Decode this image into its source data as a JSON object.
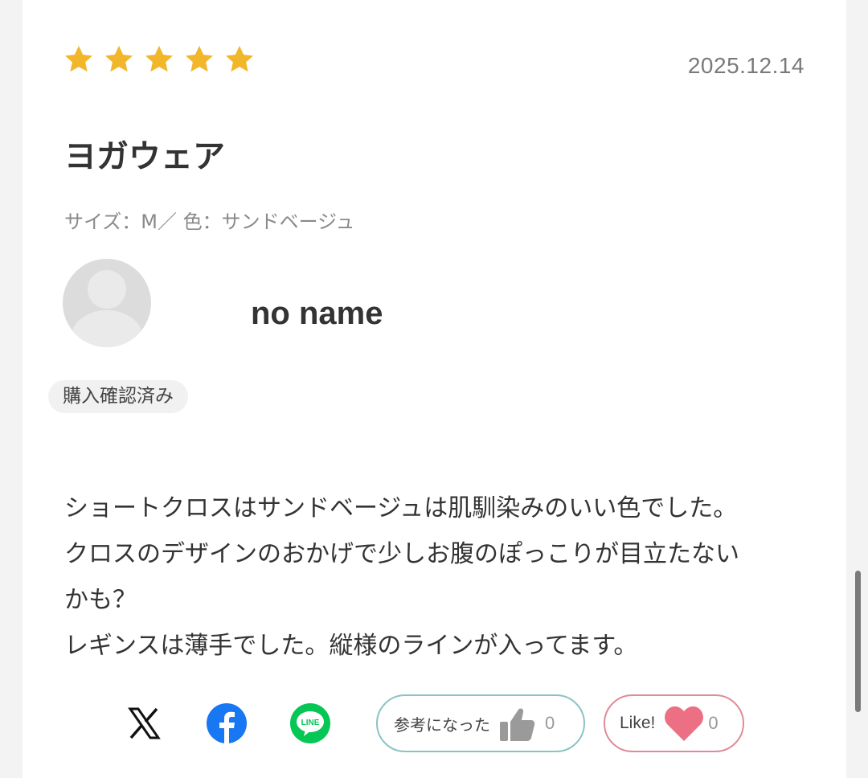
{
  "review": {
    "rating": 5,
    "rating_max": 5,
    "date": "2025.12.14",
    "title": "ヨガウェア",
    "variant": "サイズ：M／ 色：サンドベージュ",
    "reviewer_name": "no name",
    "verified_badge": "購入確認済み",
    "body_lines": [
      "ショートクロスはサンドベージュは肌馴染みのいい色でした。",
      "クロスのデザインのおかげで少しお腹のぽっこりが目立たない",
      "かも？",
      "レギンスは薄手でした。縦様のラインが入ってます。"
    ]
  },
  "actions": {
    "share_icons": [
      "x-icon",
      "facebook-icon",
      "line-icon"
    ],
    "helpful_label": "参考になった",
    "helpful_count": "0",
    "like_label": "Like!",
    "like_count": "0"
  },
  "colors": {
    "star": "#f2b62b",
    "facebook": "#1877f2",
    "line": "#06c755",
    "helpful_border": "#8cc3c2",
    "like_border": "#e08b98",
    "heart": "#ec6f83"
  }
}
